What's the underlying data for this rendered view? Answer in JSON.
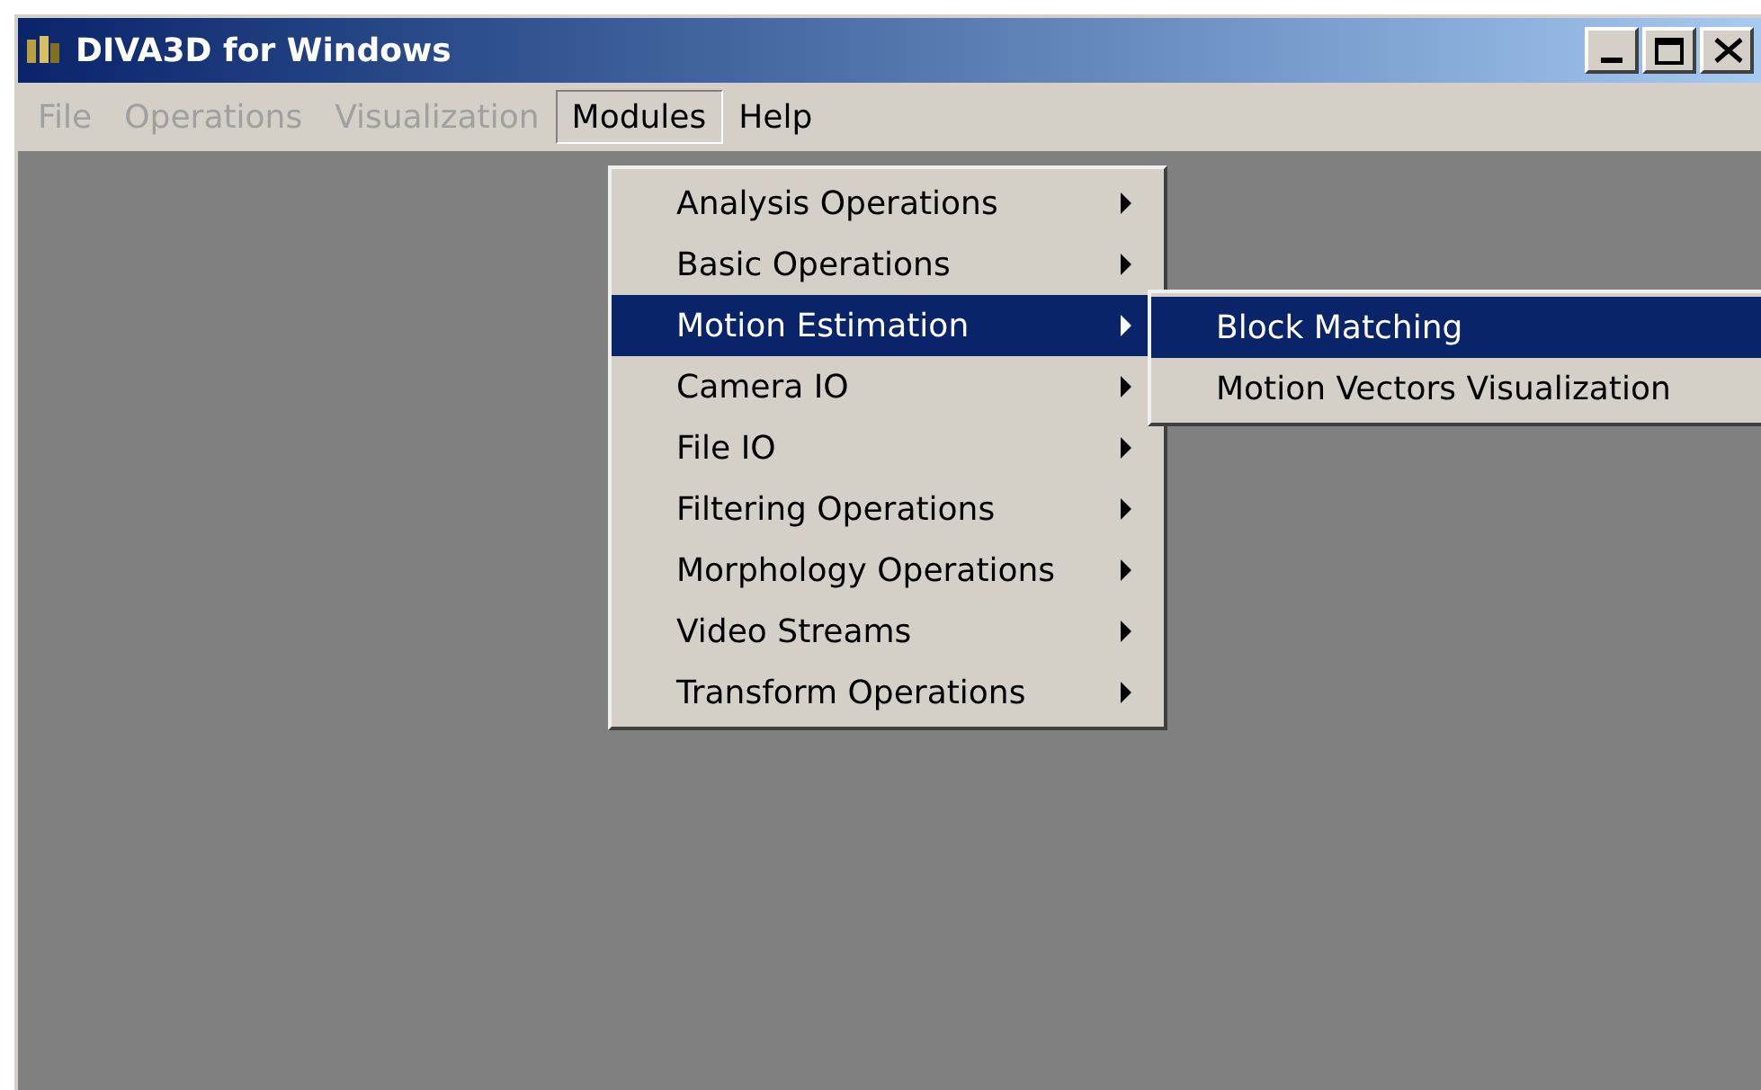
{
  "window": {
    "title": "DIVA3D for Windows"
  },
  "menu_bar": [
    {
      "label": "File",
      "disabled": true,
      "selected": false
    },
    {
      "label": "Operations",
      "disabled": true,
      "selected": false
    },
    {
      "label": "Visualization",
      "disabled": true,
      "selected": false
    },
    {
      "label": "Modules",
      "disabled": false,
      "selected": true
    },
    {
      "label": "Help",
      "disabled": false,
      "selected": false
    }
  ],
  "modules_menu": [
    {
      "label": "Analysis Operations",
      "selected": false
    },
    {
      "label": "Basic Operations",
      "selected": false
    },
    {
      "label": "Motion Estimation",
      "selected": true
    },
    {
      "label": "Camera IO",
      "selected": false
    },
    {
      "label": "File IO",
      "selected": false
    },
    {
      "label": "Filtering Operations",
      "selected": false
    },
    {
      "label": "Morphology Operations",
      "selected": false
    },
    {
      "label": "Video Streams",
      "selected": false
    },
    {
      "label": "Transform Operations",
      "selected": false
    }
  ],
  "submenu": [
    {
      "label": "Block Matching",
      "selected": true
    },
    {
      "label": "Motion Vectors Visualization",
      "selected": false
    }
  ]
}
